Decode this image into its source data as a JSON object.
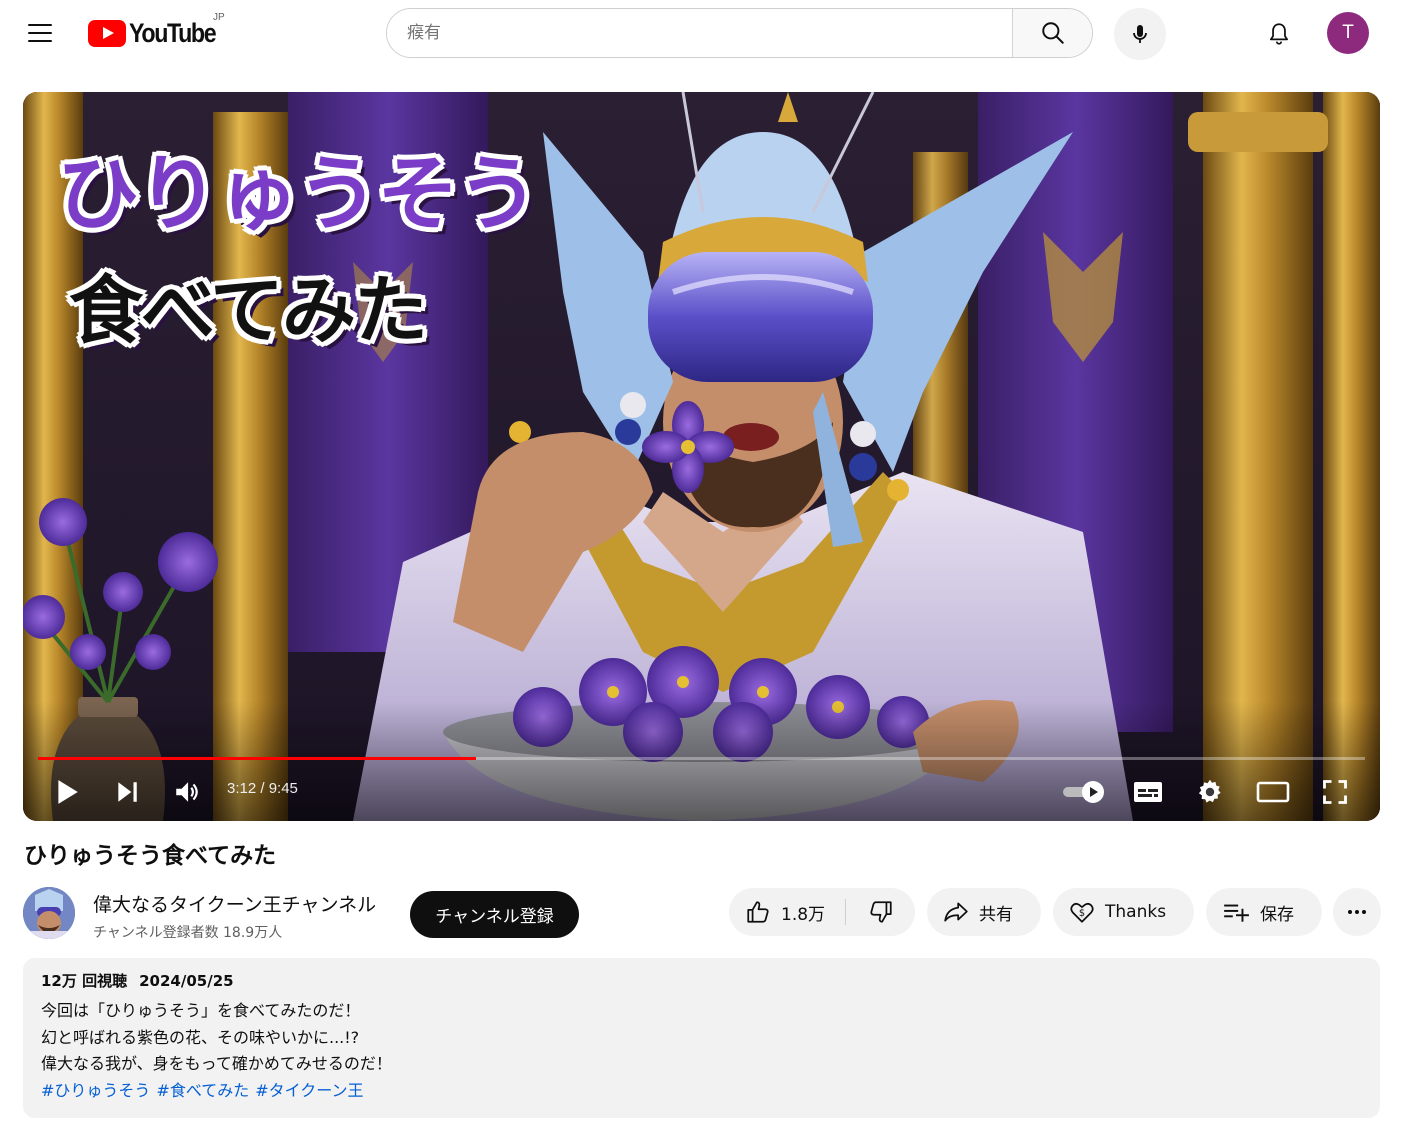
{
  "header": {
    "logo_text": "YouTube",
    "region": "JP",
    "search_value": "",
    "search_placeholder": "瘊有",
    "avatar_letter": "T"
  },
  "player": {
    "thumbnail_line1": "ひりゅうそう",
    "thumbnail_line2": "食べてみた",
    "time": "3:12 / 9:45",
    "progress_fraction": 0.33,
    "autoplay_on": true
  },
  "video": {
    "title": "ひりゅうそう食べてみた"
  },
  "channel": {
    "name": "偉大なるタイクーン王チャンネル",
    "subscribers": "チャンネル登録者数 18.9万人",
    "subscribe_label": "チャンネル登録"
  },
  "actions": {
    "like_count": "1.8万",
    "share_label": "共有",
    "thanks_label": "Thanks",
    "save_label": "保存"
  },
  "description": {
    "views": "12万 回視聴",
    "date": "2024/05/25",
    "lines": [
      "今回は「ひりゅうそう」を食べてみたのだ！",
      "幻と呼ばれる紫色の花、その味やいかに...!?",
      "偉大なる我が、身をもって確かめてみせるのだ！"
    ],
    "hashtags": [
      "#ひりゅうそう",
      "#食べてみた",
      "#タイクーン王"
    ]
  },
  "colors": {
    "brand_red": "#ff0000",
    "hashtag_blue": "#065fd4",
    "avatar_purple": "#8e2a7e"
  }
}
